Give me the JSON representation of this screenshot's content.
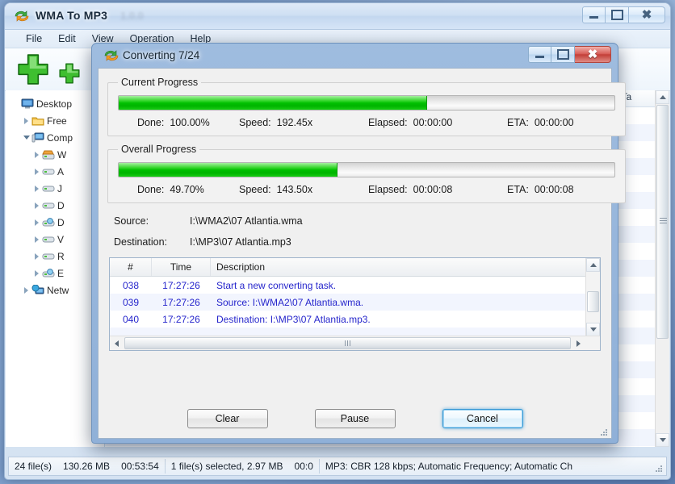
{
  "main_window": {
    "title": "WMA To MP3",
    "title_version": "1.0.0",
    "icon": "convert-arrows-icon",
    "controls": {
      "minimize": "minimize-icon",
      "maximize": "maximize-icon",
      "close": "close-icon"
    },
    "menu": [
      {
        "label": "File"
      },
      {
        "label": "Edit"
      },
      {
        "label": "View"
      },
      {
        "label": "Operation"
      },
      {
        "label": "Help"
      }
    ],
    "toolbar": [
      {
        "name": "add-files-button",
        "icon": "green-plus-large-icon"
      },
      {
        "name": "add-folder-button",
        "icon": "green-plus-small-icon"
      }
    ],
    "tree": [
      {
        "label": "Desktop",
        "icon": "desktop-icon",
        "expander": "none",
        "indent": 0
      },
      {
        "label": "Free",
        "icon": "folder-icon",
        "expander": "collapsed",
        "indent": 1
      },
      {
        "label": "Comp",
        "icon": "computer-icon",
        "expander": "expanded",
        "indent": 1
      },
      {
        "label": "W",
        "icon": "local-disk-icon",
        "expander": "collapsed",
        "indent": 2
      },
      {
        "label": "A",
        "icon": "drive-icon",
        "expander": "collapsed",
        "indent": 2
      },
      {
        "label": "J",
        "icon": "drive-icon",
        "expander": "collapsed",
        "indent": 2
      },
      {
        "label": "D",
        "icon": "drive-icon",
        "expander": "collapsed",
        "indent": 2
      },
      {
        "label": "D",
        "icon": "network-drive-icon",
        "expander": "collapsed",
        "indent": 2
      },
      {
        "label": "V",
        "icon": "drive-icon",
        "expander": "collapsed",
        "indent": 2
      },
      {
        "label": "R",
        "icon": "drive-icon",
        "expander": "collapsed",
        "indent": 2
      },
      {
        "label": "E",
        "icon": "network-drive-icon",
        "expander": "collapsed",
        "indent": 2
      },
      {
        "label": "Netw",
        "icon": "network-icon",
        "expander": "collapsed",
        "indent": 1
      }
    ],
    "list_columns": [
      {
        "label": "Ta"
      }
    ],
    "statusbar": [
      {
        "label": "24 file(s)"
      },
      {
        "label": "130.26 MB"
      },
      {
        "label": "00:53:54"
      },
      {
        "label": "1 file(s) selected, 2.97 MB"
      },
      {
        "label": "00:0"
      },
      {
        "label": "MP3:  CBR 128 kbps; Automatic Frequency; Automatic Ch"
      }
    ]
  },
  "dialog": {
    "title": "Converting 7/24",
    "icon": "convert-arrows-icon",
    "controls": {
      "minimize": "minimize-icon",
      "maximize": "maximize-icon",
      "close": "close-icon"
    },
    "current_progress": {
      "legend": "Current Progress",
      "fill_percent": 62,
      "done_label": "Done:",
      "done_value": "100.00%",
      "speed_label": "Speed:",
      "speed_value": "192.45x",
      "elapsed_label": "Elapsed:",
      "elapsed_value": "00:00:00",
      "eta_label": "ETA:",
      "eta_value": "00:00:00"
    },
    "overall_progress": {
      "legend": "Overall Progress",
      "fill_percent": 44,
      "done_label": "Done:",
      "done_value": "49.70%",
      "speed_label": "Speed:",
      "speed_value": "143.50x",
      "elapsed_label": "Elapsed:",
      "elapsed_value": "00:00:08",
      "eta_label": "ETA:",
      "eta_value": "00:00:08"
    },
    "source_label": "Source:",
    "source_value": "I:\\WMA2\\07 Atlantia.wma",
    "destination_label": "Destination:",
    "destination_value": "I:\\MP3\\07 Atlantia.mp3",
    "log": {
      "columns": {
        "num": "#",
        "time": "Time",
        "description": "Description"
      },
      "rows": [
        {
          "num": "038",
          "time": "17:27:26",
          "description": "Start a new converting task."
        },
        {
          "num": "039",
          "time": "17:27:26",
          "description": "Source:  I:\\WMA2\\07 Atlantia.wma."
        },
        {
          "num": "040",
          "time": "17:27:26",
          "description": "Destination: I:\\MP3\\07 Atlantia.mp3."
        }
      ]
    },
    "buttons": {
      "clear": "Clear",
      "pause": "Pause",
      "cancel": "Cancel"
    }
  },
  "colors": {
    "progress_green": "#00c000",
    "log_text_blue": "#2626cc",
    "focus_blue": "#3c9bd6",
    "close_red": "#c33f38"
  }
}
